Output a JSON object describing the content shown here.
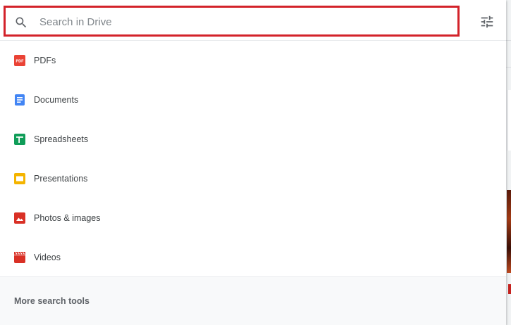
{
  "search": {
    "placeholder": "Search in Drive",
    "value": "",
    "highlight_color": "#d3222a"
  },
  "filter_button": {
    "icon": "tune-icon"
  },
  "file_types": [
    {
      "label": "PDFs",
      "icon": "pdf-icon",
      "color": "#ea4335"
    },
    {
      "label": "Documents",
      "icon": "docs-icon",
      "color": "#4285f4"
    },
    {
      "label": "Spreadsheets",
      "icon": "sheets-icon",
      "color": "#0f9d58"
    },
    {
      "label": "Presentations",
      "icon": "slides-icon",
      "color": "#f4b400"
    },
    {
      "label": "Photos & images",
      "icon": "image-icon",
      "color": "#d93025"
    },
    {
      "label": "Videos",
      "icon": "video-icon",
      "color": "#d93025"
    }
  ],
  "footer": {
    "more_tools_label": "More search tools"
  }
}
